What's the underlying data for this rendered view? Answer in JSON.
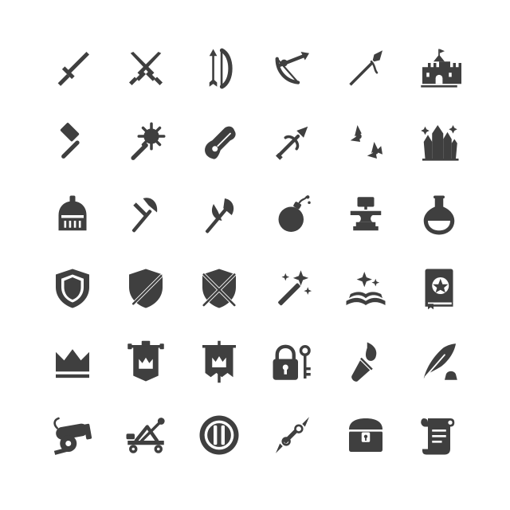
{
  "colors": {
    "icon": "#3f3f3f",
    "background": "#ffffff"
  },
  "icon_rows": [
    [
      "sword-icon",
      "crossed-swords-icon",
      "bow-and-arrow-icon",
      "crossbow-icon",
      "spear-icon",
      "castle-icon"
    ],
    [
      "war-hammer-icon",
      "mace-icon",
      "lute-icon",
      "crossbow-bolt-icon",
      "shuriken-icon",
      "crystals-icon"
    ],
    [
      "knight-helmet-icon",
      "axe-icon",
      "double-axe-icon",
      "bomb-icon",
      "anvil-icon",
      "potion-icon"
    ],
    [
      "shield-icon",
      "shield-sword-icon",
      "crossed-swords-shield-icon",
      "magic-wand-icon",
      "magic-book-icon",
      "spell-book-icon"
    ],
    [
      "crown-icon",
      "banner-icon",
      "flag-crown-icon",
      "lock-and-key-icon",
      "torch-icon",
      "quill-icon"
    ],
    [
      "cannon-icon",
      "catapult-icon",
      "round-shield-icon",
      "double-dagger-icon",
      "treasure-chest-icon",
      "scroll-icon"
    ]
  ]
}
